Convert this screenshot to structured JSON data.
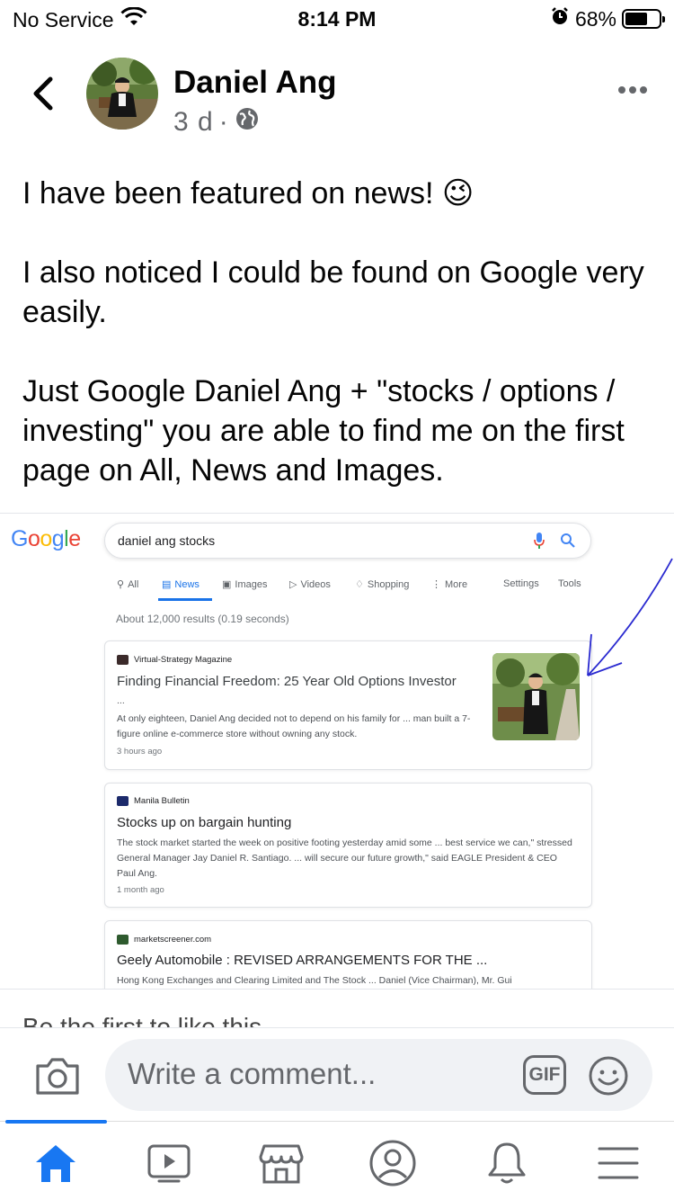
{
  "status_bar": {
    "carrier": "No Service",
    "time": "8:14 PM",
    "battery_percent": "68%",
    "battery_level": 0.68
  },
  "post": {
    "author": "Daniel Ang",
    "time_ago": "3 d",
    "separator": "·",
    "paragraphs": [
      "I have been featured on news! 😉",
      "I also noticed I could be found on Google very easily.",
      "Just Google Daniel Ang + \"stocks / options / investing\" you are able to find me on the first page on All, News and Images."
    ]
  },
  "google_screenshot": {
    "logo": "Google",
    "search_query": "daniel ang stocks",
    "tabs": [
      "All",
      "News",
      "Images",
      "Videos",
      "Shopping",
      "More",
      "Settings",
      "Tools"
    ],
    "active_tab": "News",
    "results_count": "About 12,000 results (0.19 seconds)",
    "results": [
      {
        "source": "Virtual-Strategy Magazine",
        "title": "Finding Financial Freedom: 25 Year Old Options Investor",
        "ellipsis": "...",
        "snippet": "At only eighteen, Daniel Ang decided not to depend on his family for ... man built a 7-figure online e-commerce store without owning any stock.",
        "age": "3 hours ago"
      },
      {
        "source": "Manila Bulletin",
        "title": "Stocks up on bargain hunting",
        "snippet": "The stock market started the week on positive footing yesterday amid some ... best service we can,\" stressed General Manager Jay Daniel R. Santiago. ... will secure our future growth,\" said EAGLE President & CEO Paul Ang.",
        "age": "1 month ago"
      },
      {
        "source": "marketscreener.com",
        "title": "Geely Automobile : REVISED ARRANGEMENTS FOR THE ...",
        "snippet": "Hong Kong Exchanges and Clearing Limited and The Stock ... Daniel (Vice Chairman), Mr. Gui"
      }
    ]
  },
  "like_prompt": "Be the first to like this",
  "comment": {
    "placeholder": "Write a comment...",
    "gif_label": "GIF"
  },
  "colors": {
    "facebook_blue": "#1877f2",
    "google_blue": "#1a73e8",
    "annotation_ink": "#2a2ad0"
  }
}
